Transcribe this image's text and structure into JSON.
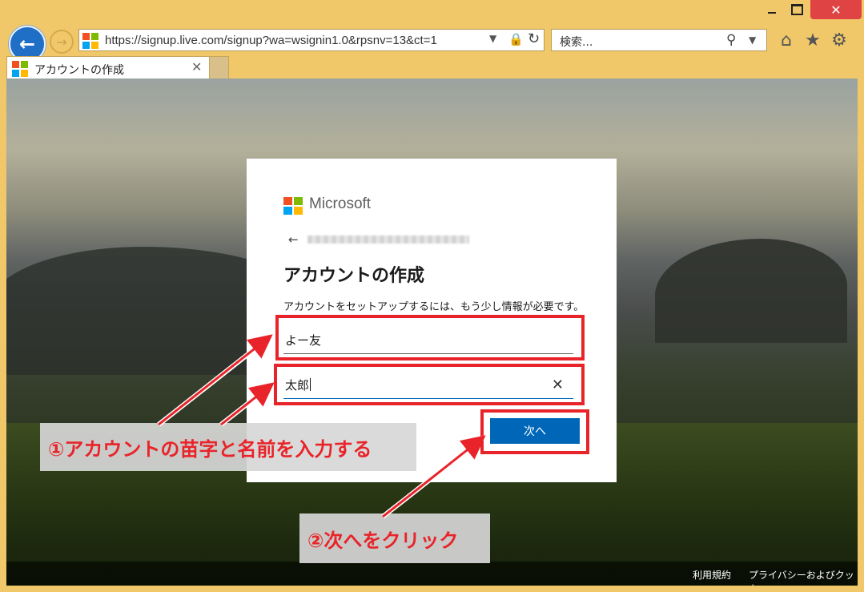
{
  "browser": {
    "url": "https://signup.live.com/signup?wa=wsignin1.0&rpsnv=13&ct=1",
    "search_placeholder": "検索...",
    "tab_title": "アカウントの作成",
    "icons": [
      "back-icon",
      "forward-icon",
      "lock-icon",
      "refresh-icon",
      "search-icon",
      "home-icon",
      "favorites-star-icon",
      "settings-gear-icon"
    ]
  },
  "card": {
    "logo_text": "Microsoft",
    "heading": "アカウントの作成",
    "description": "アカウントをセットアップするには、もう少し情報が必要です。",
    "last_name_value": "よー友",
    "first_name_value": "太郎",
    "next_label": "次へ"
  },
  "footer": {
    "terms": "利用規約",
    "privacy": "プライバシーおよびクッキー"
  },
  "annotations": {
    "step1": "①アカウントの苗字と名前を入力する",
    "step2": "②次へをクリック"
  },
  "colors": {
    "accent": "#0067b8",
    "annotation_red": "#e8242a",
    "ms_red": "#f25022",
    "ms_green": "#7fba00",
    "ms_blue": "#00a4ef",
    "ms_yellow": "#ffb900"
  }
}
